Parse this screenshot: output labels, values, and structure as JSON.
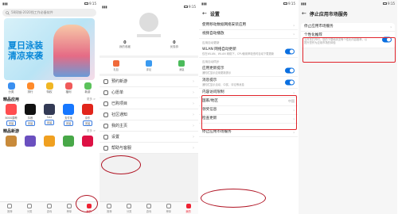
{
  "status_bar": {
    "time": "9:15"
  },
  "colors": {
    "accent": "#0a6fe0",
    "highlight": "#e0232a",
    "tab_active": "#e22233"
  },
  "store": {
    "search_placeholder": "58同城-2020找工作必备软件",
    "banner_title": "夏日泳装 清凉来袭",
    "categories": [
      "分类",
      "排行",
      "特权",
      "福利",
      "新游"
    ],
    "featured_header": "精品应用",
    "featured_more": "更多 >",
    "featured_apps": [
      "BOSS直聘",
      "抖音",
      "Soul",
      "支付宝",
      "京东"
    ],
    "install_label": "安装",
    "newgame_header": "精品新游",
    "newgame_more": "更多 >",
    "tabs": [
      "推荐",
      "分类",
      "游戏",
      "榜单",
      "我的"
    ]
  },
  "mine": {
    "stats": [
      {
        "value": "0",
        "label": "我的收藏"
      },
      {
        "value": "0",
        "label": "优惠券"
      }
    ],
    "quick": [
      "礼包",
      "评论",
      "消息"
    ],
    "menu": [
      "预约新游",
      "心愿单",
      "已购项目",
      "社区通知",
      "我的主页",
      "设置",
      "帮助与客服"
    ],
    "tabs": [
      "推荐",
      "分类",
      "游戏",
      "榜单",
      "我的"
    ]
  },
  "settings": {
    "title": "设置",
    "items": [
      {
        "title": "使用移动数据网络安装应用",
        "desc": "",
        "value": "",
        "toggle": false
      },
      {
        "title": "视频自动播放",
        "desc": "",
        "value": "",
        "toggle": false
      },
      {
        "title": "应用自动更新",
        "desc": "",
        "value": "",
        "toggle": false
      },
      {
        "title": "WLAN 网络自动更新",
        "desc": "仅在WLAN、WLAN 网络下，CPU使用率较低时自动下载更新",
        "value": "",
        "toggle": true
      },
      {
        "title": "应用自动同步",
        "desc": "",
        "value": "",
        "toggle": false
      },
      {
        "title": "应用更新提示",
        "desc": "通知栏显示应用更新提示",
        "value": "",
        "toggle": true
      },
      {
        "title": "消息提示",
        "desc": "通知栏显示活动、中奖、评论等消息",
        "value": "",
        "toggle": true
      },
      {
        "title": "内容访问限制",
        "desc": "",
        "value": "",
        "toggle": false
      },
      {
        "title": "国家/地区",
        "desc": "",
        "value": "中国",
        "toggle": false
      },
      {
        "title": "领奖信息",
        "desc": "",
        "value": "",
        "toggle": false
      },
      {
        "title": "检查更新",
        "desc": "",
        "value": "",
        "toggle": false
      },
      {
        "title": "停止应用市场服务",
        "desc": "",
        "value": "",
        "toggle": false
      }
    ]
  },
  "stop_service": {
    "title": "停止应用市场服务",
    "section": "停止应用市场服务",
    "pref_title": "个性化推荐",
    "pref_desc": "当开关打开时，您的下载和浏览等个性化内容推荐，以提升您作为应用市场的体验"
  }
}
